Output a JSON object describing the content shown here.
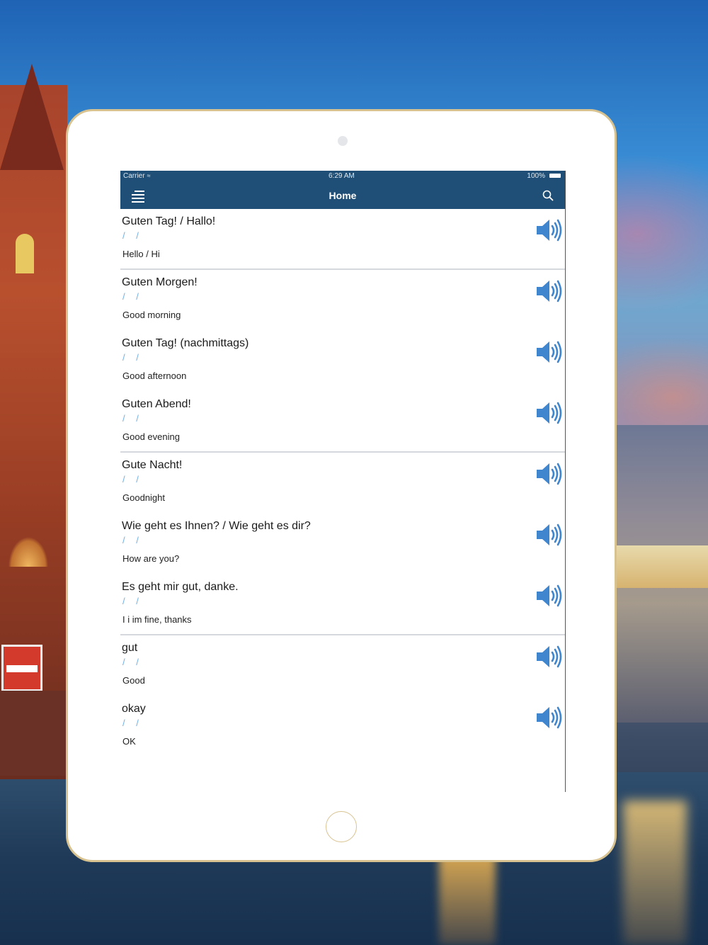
{
  "app": {
    "status_bar": {
      "carrier": "Carrier",
      "time": "6:29 AM",
      "battery": "100%"
    },
    "nav": {
      "title": "Home",
      "menu_icon": "hamburger-menu-icon",
      "search_icon": "search-icon"
    },
    "colors": {
      "nav_bg": "#1f4f76",
      "pron_text": "#6fb0e6",
      "speaker": "#3f86cf"
    },
    "phrases": [
      {
        "german": "Guten Tag! / Hallo!",
        "pronunciation": "/ /",
        "english": "Hello / Hi"
      },
      {
        "german": "Guten Morgen!",
        "pronunciation": "/ /",
        "english": "Good morning"
      },
      {
        "german": "Guten Tag! (nachmittags)",
        "pronunciation": "/ /",
        "english": "Good afternoon"
      },
      {
        "german": "Guten Abend!",
        "pronunciation": "/ /",
        "english": "Good evening"
      },
      {
        "german": "Gute Nacht!",
        "pronunciation": "/ /",
        "english": "Goodnight"
      },
      {
        "german": "Wie geht es Ihnen? / Wie geht es dir?",
        "pronunciation": "/ /",
        "english": "How are you?"
      },
      {
        "german": "Es geht mir gut, danke.",
        "pronunciation": "/ /",
        "english": "I i im fine, thanks"
      },
      {
        "german": "gut",
        "pronunciation": "/ /",
        "english": "Good"
      },
      {
        "german": "okay",
        "pronunciation": "/ /",
        "english": "OK"
      }
    ]
  }
}
